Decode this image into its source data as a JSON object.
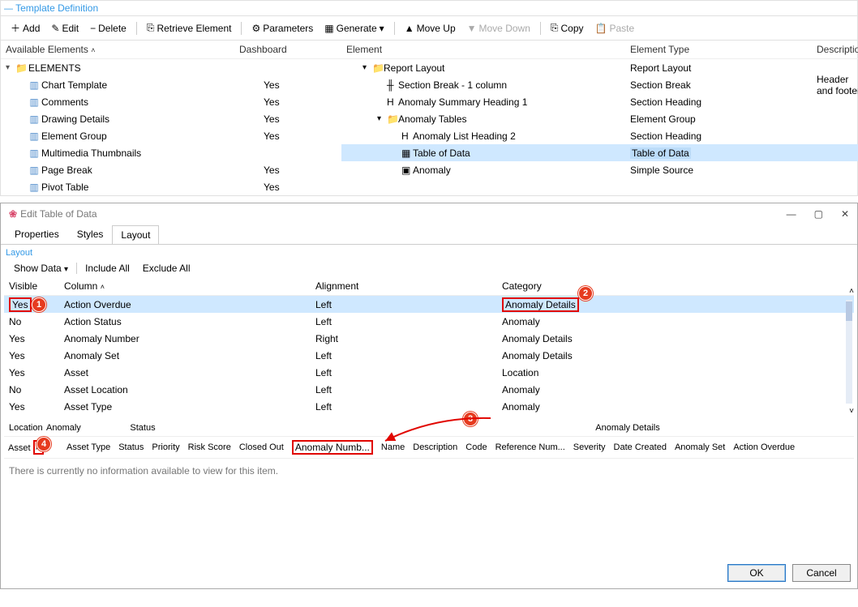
{
  "template": {
    "title": "Template Definition",
    "toolbar": {
      "add": "Add",
      "edit": "Edit",
      "delete": "Delete",
      "retrieve": "Retrieve Element",
      "parameters": "Parameters",
      "generate": "Generate",
      "moveup": "Move Up",
      "movedown": "Move Down",
      "copy": "Copy",
      "paste": "Paste"
    },
    "left": {
      "header_a": "Available Elements",
      "header_b": "Dashboard",
      "root": "ELEMENTS",
      "rows": [
        {
          "label": "Chart Template",
          "dash": "Yes"
        },
        {
          "label": "Comments",
          "dash": "Yes"
        },
        {
          "label": "Drawing Details",
          "dash": "Yes"
        },
        {
          "label": "Element Group",
          "dash": "Yes"
        },
        {
          "label": "Multimedia Thumbnails",
          "dash": ""
        },
        {
          "label": "Page Break",
          "dash": "Yes"
        },
        {
          "label": "Pivot Table",
          "dash": "Yes"
        }
      ]
    },
    "right": {
      "header_a": "Element",
      "header_b": "Element Type",
      "header_c": "Description",
      "rows": [
        {
          "indent": 0,
          "arrow": "▾",
          "icon": "folder",
          "label": "Report Layout",
          "type": "Report Layout",
          "desc": ""
        },
        {
          "indent": 1,
          "arrow": "",
          "icon": "sec",
          "label": "Section Break - 1 column",
          "type": "Section Break",
          "desc": "Header and footer"
        },
        {
          "indent": 1,
          "arrow": "",
          "icon": "h1",
          "label": "Anomaly Summary Heading 1",
          "type": "Section Heading",
          "desc": ""
        },
        {
          "indent": 1,
          "arrow": "▾",
          "icon": "folder",
          "label": "Anomaly Tables",
          "type": "Element Group",
          "desc": ""
        },
        {
          "indent": 2,
          "arrow": "",
          "icon": "h1",
          "label": "Anomaly List Heading 2",
          "type": "Section Heading",
          "desc": ""
        },
        {
          "indent": 2,
          "arrow": "",
          "icon": "table",
          "label": "Table of Data",
          "type": "Table of Data",
          "desc": "",
          "selected": true
        },
        {
          "indent": 2,
          "arrow": "",
          "icon": "src",
          "label": "Anomaly",
          "type": "Simple Source",
          "desc": ""
        }
      ]
    }
  },
  "dialog": {
    "title": "Edit Table of Data",
    "tabs": {
      "properties": "Properties",
      "styles": "Styles",
      "layout": "Layout"
    },
    "layout_title": "Layout",
    "layout_toolbar": {
      "show_data": "Show Data",
      "include_all": "Include All",
      "exclude_all": "Exclude All"
    },
    "grid_headers": {
      "visible": "Visible",
      "column": "Column",
      "alignment": "Alignment",
      "category": "Category"
    },
    "grid_rows": [
      {
        "vis": "Yes",
        "col": "Action Overdue",
        "align": "Left",
        "cat": "Anomaly Details",
        "selected": true,
        "badge1": true,
        "badge2": true,
        "redbox_vis": true,
        "redbox_cat": true
      },
      {
        "vis": "No",
        "col": "Action Status",
        "align": "Left",
        "cat": "Anomaly"
      },
      {
        "vis": "Yes",
        "col": "Anomaly Number",
        "align": "Right",
        "cat": "Anomaly Details"
      },
      {
        "vis": "Yes",
        "col": "Anomaly Set",
        "align": "Left",
        "cat": "Anomaly Details"
      },
      {
        "vis": "Yes",
        "col": "Asset",
        "align": "Left",
        "cat": "Location"
      },
      {
        "vis": "No",
        "col": "Asset Location",
        "align": "Left",
        "cat": "Anomaly"
      },
      {
        "vis": "Yes",
        "col": "Asset Type",
        "align": "Left",
        "cat": "Anomaly"
      }
    ],
    "preview_groups": {
      "location": "Location",
      "anomaly": "Anomaly",
      "status": "Status",
      "details": "Anomaly Details"
    },
    "preview_cols": [
      "Asset",
      "Asset Type",
      "Status",
      "Priority",
      "Risk Score",
      "Closed Out",
      "Anomaly Numb...",
      "Name",
      "Description",
      "Code",
      "Reference Num...",
      "Severity",
      "Date Created",
      "Anomaly Set",
      "Action Overdue"
    ],
    "empty": "There is currently no information available to view for this item.",
    "buttons": {
      "ok": "OK",
      "cancel": "Cancel"
    },
    "badges": {
      "b1": "1",
      "b2": "2",
      "b3": "3",
      "b4": "4"
    }
  }
}
